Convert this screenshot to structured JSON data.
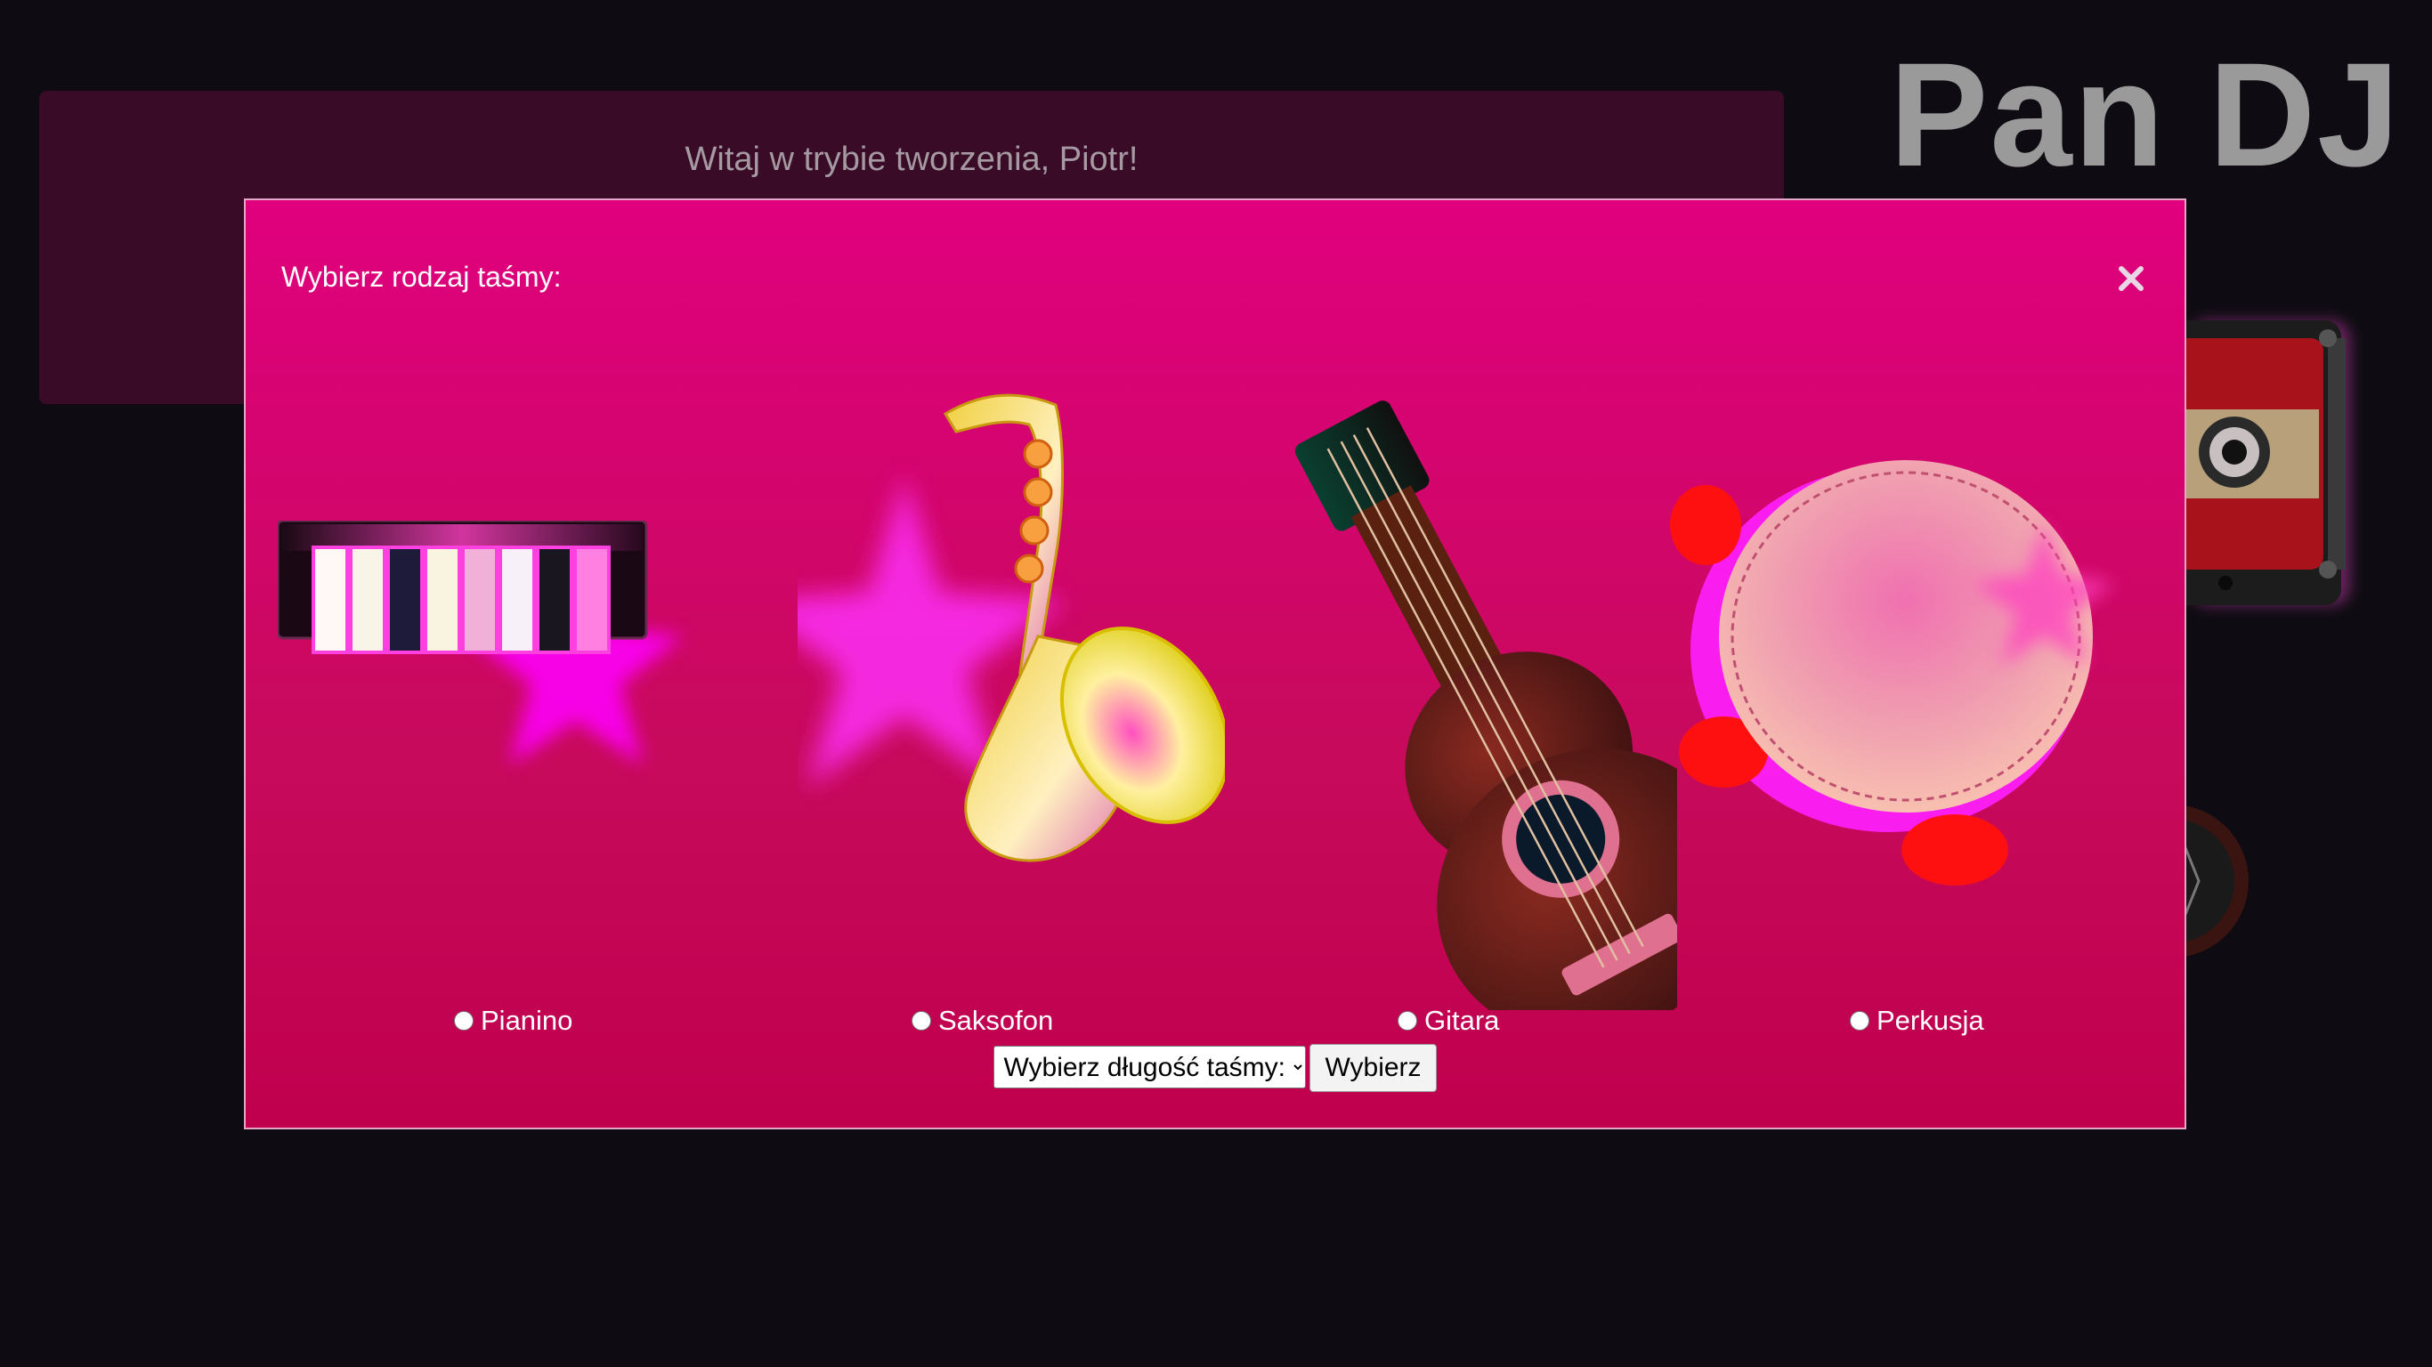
{
  "header": {
    "welcome": "Witaj w trybie tworzenia, Piotr!",
    "app_title": "Pan DJ"
  },
  "modal": {
    "title": "Wybierz rodzaj taśmy:",
    "close_icon": "close-icon",
    "options": [
      {
        "label": "Pianino",
        "icon": "piano-icon",
        "selected": false
      },
      {
        "label": "Saksofon",
        "icon": "saxophone-icon",
        "selected": false
      },
      {
        "label": "Gitara",
        "icon": "guitar-icon",
        "selected": false
      },
      {
        "label": "Perkusja",
        "icon": "tambourine-icon",
        "selected": false
      }
    ],
    "length_select": {
      "selected": "Wybierz długość taśmy:"
    },
    "choose_button": "Wybierz"
  },
  "colors": {
    "background": "#0e0c12",
    "panel": "#3a0b27",
    "modal_top": "#e0007e",
    "modal_bottom": "#c0004d",
    "accent_magenta": "#ff00ff"
  }
}
